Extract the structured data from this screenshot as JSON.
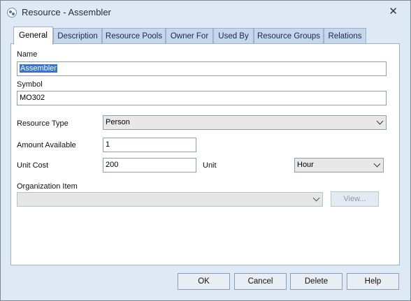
{
  "window": {
    "title": "Resource - Assembler",
    "close_glyph": "✕"
  },
  "tabs": [
    {
      "label": "General",
      "active": true
    },
    {
      "label": "Description",
      "active": false
    },
    {
      "label": "Resource Pools",
      "active": false
    },
    {
      "label": "Owner For",
      "active": false
    },
    {
      "label": "Used By",
      "active": false
    },
    {
      "label": "Resource Groups",
      "active": false
    },
    {
      "label": "Relations",
      "active": false
    }
  ],
  "form": {
    "name_label": "Name",
    "name_value": "Assembler",
    "symbol_label": "Symbol",
    "symbol_value": "MO302",
    "resource_type_label": "Resource Type",
    "resource_type_value": "Person",
    "amount_label": "Amount Available",
    "amount_value": "1",
    "unit_cost_label": "Unit Cost",
    "unit_cost_value": "200",
    "unit_label": "Unit",
    "unit_value": "Hour",
    "org_item_label": "Organization Item",
    "org_item_value": "",
    "view_button": "View..."
  },
  "buttons": {
    "ok": "OK",
    "cancel": "Cancel",
    "delete": "Delete",
    "help": "Help"
  }
}
